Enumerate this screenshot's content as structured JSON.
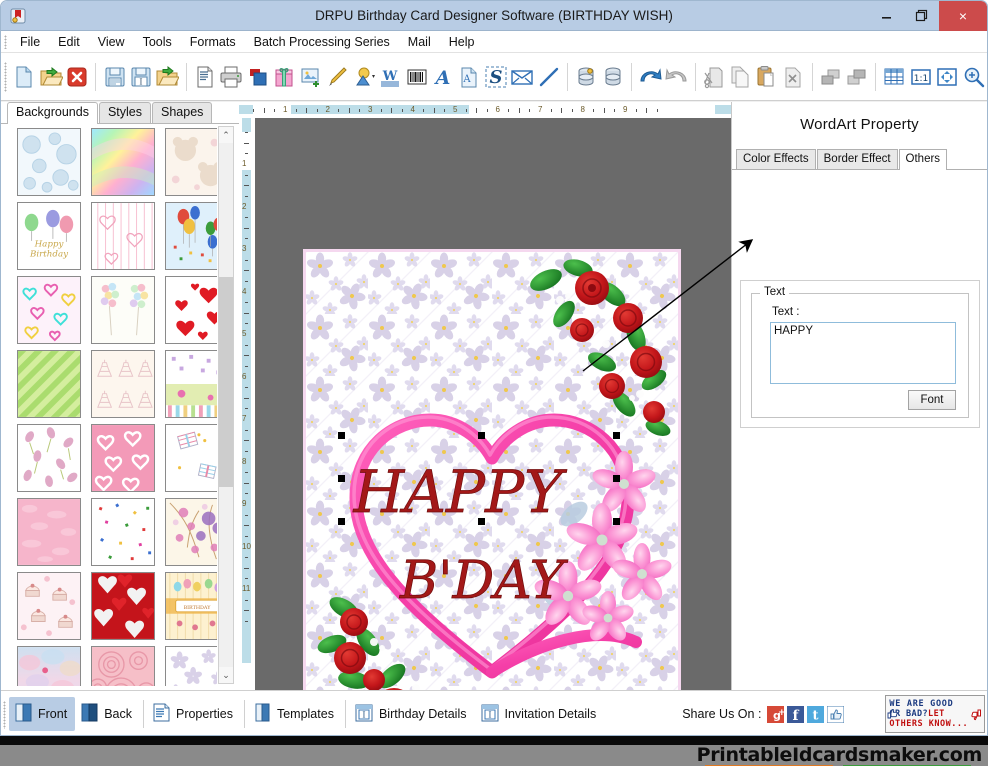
{
  "window": {
    "title": "DRPU Birthday Card Designer Software (BIRTHDAY WISH)",
    "app_icon": "app-logo-icon",
    "minimize": "–",
    "maximize": "❐",
    "close": "×",
    "titlebar_color": "#b8cce4",
    "close_color": "#cc4b4b"
  },
  "menu": {
    "items": [
      {
        "label": "File"
      },
      {
        "label": "Edit"
      },
      {
        "label": "View"
      },
      {
        "label": "Tools"
      },
      {
        "label": "Formats"
      },
      {
        "label": "Batch Processing Series"
      },
      {
        "label": "Mail"
      },
      {
        "label": "Help"
      }
    ]
  },
  "toolbar": {
    "groups": [
      {
        "buttons": [
          {
            "icon": "new-document-icon",
            "name": "new-card"
          },
          {
            "icon": "open-folder-icon",
            "name": "open-card"
          },
          {
            "icon": "close-red-x-icon",
            "name": "close-card"
          }
        ]
      },
      {
        "buttons": [
          {
            "icon": "save-floppy-icon",
            "name": "save-card"
          },
          {
            "icon": "save-as-floppy-icon",
            "name": "save-as-card"
          },
          {
            "icon": "export-folder-icon",
            "name": "export-card"
          }
        ]
      },
      {
        "buttons": [
          {
            "icon": "print-preview-icon",
            "name": "print-preview"
          },
          {
            "icon": "printer-icon",
            "name": "print"
          },
          {
            "icon": "card-properties-icon",
            "name": "card-properties"
          },
          {
            "icon": "gift-box-icon",
            "name": "gift-templates"
          },
          {
            "icon": "add-image-icon",
            "name": "insert-image"
          },
          {
            "icon": "pen-icon",
            "name": "signature-pen"
          },
          {
            "icon": "shapes-fill-icon",
            "name": "shapes-fill"
          },
          {
            "icon": "watermark-w-icon",
            "name": "watermark"
          },
          {
            "icon": "barcode-icon",
            "name": "insert-barcode"
          },
          {
            "icon": "text-a-icon",
            "name": "insert-text"
          },
          {
            "icon": "text-page-icon",
            "name": "insert-text-page"
          },
          {
            "icon": "wordart-s-icon",
            "name": "insert-wordart"
          },
          {
            "icon": "envelope-icon",
            "name": "mail-card"
          },
          {
            "icon": "line-icon",
            "name": "draw-line"
          }
        ]
      },
      {
        "buttons": [
          {
            "icon": "database-gold-icon",
            "name": "database-connect"
          },
          {
            "icon": "database-icon",
            "name": "database"
          }
        ]
      },
      {
        "buttons": [
          {
            "icon": "undo-icon",
            "name": "undo"
          },
          {
            "icon": "redo-icon",
            "name": "redo"
          }
        ]
      },
      {
        "buttons": [
          {
            "icon": "cut-scissors-icon",
            "name": "cut"
          },
          {
            "icon": "copy-icon",
            "name": "copy"
          },
          {
            "icon": "paste-clipboard-icon",
            "name": "paste"
          },
          {
            "icon": "delete-page-icon",
            "name": "delete"
          }
        ]
      },
      {
        "buttons": [
          {
            "icon": "bring-to-front-icon",
            "name": "bring-to-front"
          },
          {
            "icon": "send-to-back-icon",
            "name": "send-to-back"
          }
        ]
      },
      {
        "buttons": [
          {
            "icon": "grid-icon",
            "name": "toggle-grid"
          },
          {
            "icon": "zoom-1to1-icon",
            "name": "zoom-actual-size"
          },
          {
            "icon": "fit-page-icon",
            "name": "fit-to-page"
          },
          {
            "icon": "zoom-in-icon",
            "name": "zoom-in"
          }
        ]
      }
    ]
  },
  "left_panel": {
    "tabs": [
      {
        "label": "Backgrounds",
        "active": true
      },
      {
        "label": "Styles",
        "active": false
      },
      {
        "label": "Shapes",
        "active": false
      }
    ],
    "thumbnails": [
      {
        "name": "bubbles-blue"
      },
      {
        "name": "rainbow-gradient"
      },
      {
        "name": "teddy-bear-beige"
      },
      {
        "name": "happy-birthday-balloons"
      },
      {
        "name": "pink-hearts-stripes"
      },
      {
        "name": "balloons-sky"
      },
      {
        "name": "neon-hearts"
      },
      {
        "name": "balloon-bouquets"
      },
      {
        "name": "red-hearts-white"
      },
      {
        "name": "green-diagonal-stripes"
      },
      {
        "name": "cream-cakes"
      },
      {
        "name": "confetti-meadow"
      },
      {
        "name": "pink-petals-scatter"
      },
      {
        "name": "pink-hearts-solid"
      },
      {
        "name": "gift-boxes-white"
      },
      {
        "name": "pink-texture"
      },
      {
        "name": "confetti-white"
      },
      {
        "name": "purple-blossom-branch"
      },
      {
        "name": "cake-slices-pink"
      },
      {
        "name": "red-white-hearts"
      },
      {
        "name": "birthday-banner-cream"
      },
      {
        "name": "pastel-petal-blur"
      },
      {
        "name": "pink-roses"
      },
      {
        "name": "lavender-blossom"
      }
    ],
    "scroll_up": "⌃",
    "scroll_down": "⌄"
  },
  "rulers": {
    "horizontal_units": [
      "1",
      "2",
      "3",
      "4",
      "5",
      "6",
      "7",
      "8",
      "9"
    ],
    "vertical_units": [
      "1",
      "2",
      "3",
      "4",
      "5",
      "6",
      "7",
      "8",
      "9",
      "10",
      "11"
    ]
  },
  "canvas": {
    "background_color": "#6a6a6a",
    "card": {
      "border_color": "#f5d8ef",
      "background_pattern": "lavender-blossom-floral",
      "heart_color": "#f53fa8",
      "wordart_lines": [
        "HAPPY",
        "B'DAY"
      ],
      "wordart_color": "#a31818",
      "decorations": [
        "red-roses-top-right",
        "red-roses-bottom-left",
        "pink-flowers-right"
      ]
    },
    "selection_handles": 8
  },
  "right_panel": {
    "title": "WordArt Property",
    "tabs": [
      {
        "label": "Color Effects",
        "active": false
      },
      {
        "label": "Border Effect",
        "active": false
      },
      {
        "label": "Others",
        "active": true
      }
    ],
    "group_legend": "Text",
    "text_label": "Text :",
    "text_value": "HAPPY",
    "font_button": "Font"
  },
  "bottom_bar": {
    "items": [
      {
        "label": "Front",
        "icon": "card-front-icon",
        "active": true
      },
      {
        "label": "Back",
        "icon": "card-back-icon",
        "active": false
      },
      {
        "label": "Properties",
        "icon": "properties-icon",
        "active": false
      },
      {
        "label": "Templates",
        "icon": "templates-icon",
        "active": false
      },
      {
        "label": "Birthday Details",
        "icon": "birthday-details-icon",
        "active": false
      },
      {
        "label": "Invitation Details",
        "icon": "invitation-details-icon",
        "active": false
      }
    ],
    "share_label": "Share Us On :",
    "share_icons": [
      {
        "name": "google-plus-icon",
        "glyph": "g+",
        "color": "#d64937"
      },
      {
        "name": "facebook-icon",
        "glyph": "f",
        "color": "#3b5998"
      },
      {
        "name": "twitter-icon",
        "glyph": "t",
        "color": "#4fa9dd"
      },
      {
        "name": "thumbs-up-icon",
        "glyph": "👍",
        "color": "#ffffff"
      }
    ],
    "feedback": {
      "line1": "WE ARE GOOD",
      "line2": "OR BAD?LET",
      "line3": "OTHERS KNOW..."
    }
  },
  "footer": {
    "brand": "PrintableIdcardsmaker.com"
  }
}
